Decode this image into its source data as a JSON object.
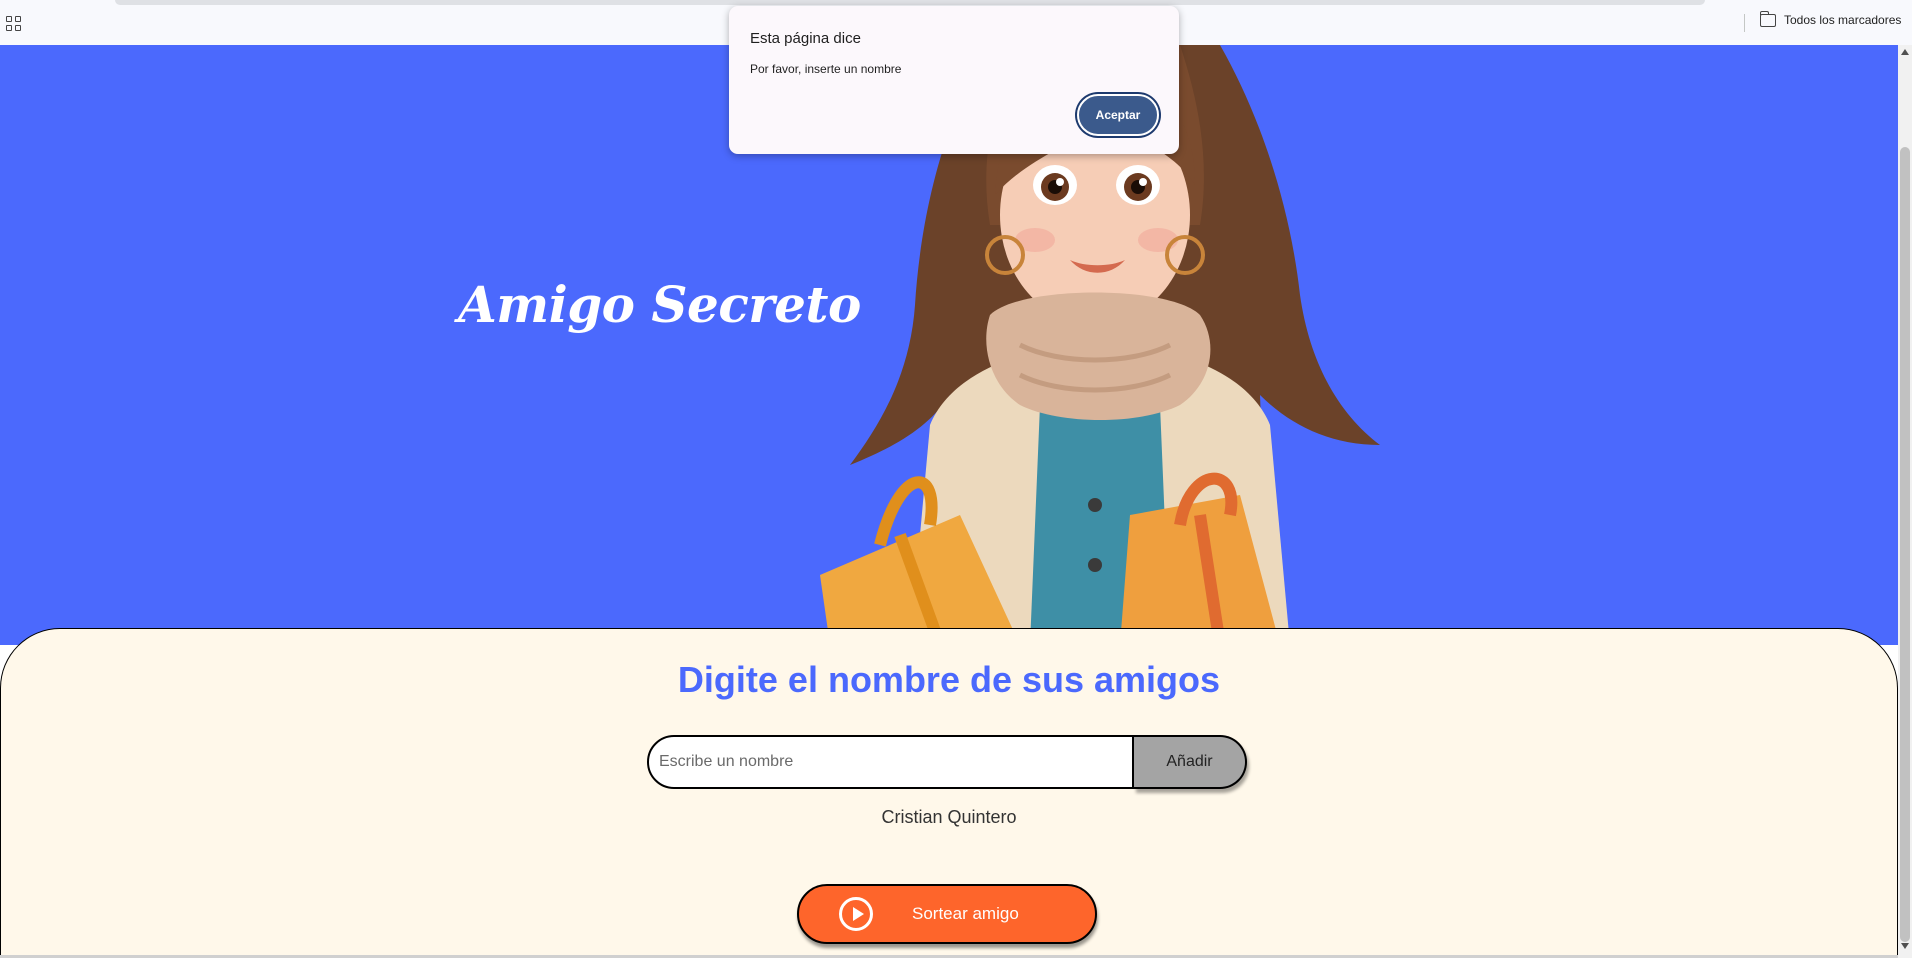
{
  "browser": {
    "bookmarks_bar": {
      "apps_icon": "apps-grid-icon",
      "all_bookmarks_label": "Todos los marcadores",
      "all_bookmarks_icon": "folder-icon"
    }
  },
  "hero": {
    "title": "Amigo Secreto",
    "background_color": "#4b69fd",
    "illustration": "girl-holding-gifts"
  },
  "main": {
    "heading": "Digite el nombre de sus amigos",
    "input": {
      "placeholder": "Escribe un nombre",
      "value": ""
    },
    "add_button_label": "Añadir",
    "friends": [
      "Cristian Quintero"
    ],
    "draw_button": {
      "label": "Sortear amigo",
      "icon": "play-circle-icon",
      "color": "#fe652b"
    }
  },
  "alert": {
    "title": "Esta página dice",
    "message": "Por favor, inserte un nombre",
    "ok_label": "Aceptar"
  }
}
